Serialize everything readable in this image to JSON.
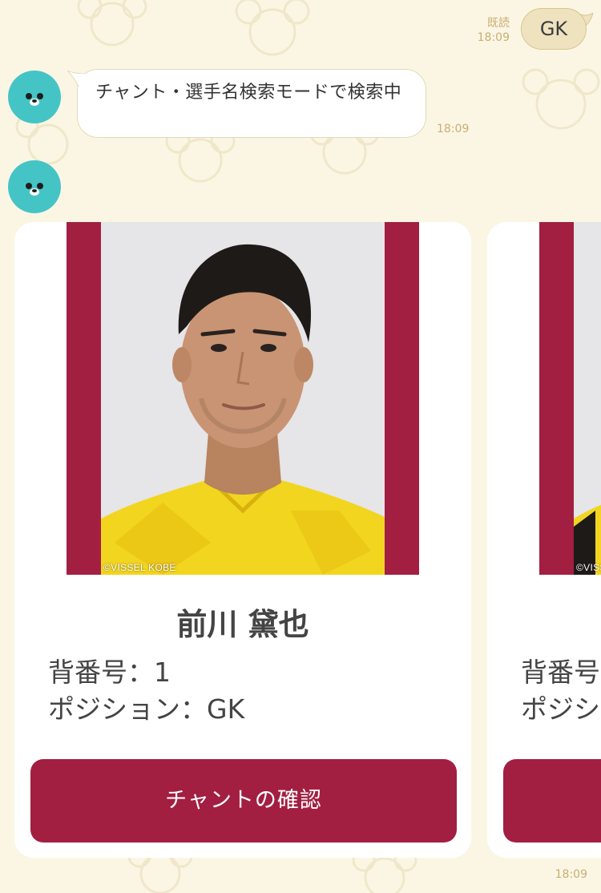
{
  "colors": {
    "chat_background": "#FBF6E4",
    "outgoing_bubble": "#EFE3BF",
    "timestamp": "#C9AE71",
    "avatar": "#45C4C6",
    "brand_crimson": "#A21F42",
    "jersey_yellow": "#F2D51E"
  },
  "outgoing_message": {
    "read_label": "既読",
    "time": "18:09",
    "text": "GK"
  },
  "bot": {
    "avatar_icon": "bear-face-icon"
  },
  "incoming_message": {
    "text": "チャント・選手名検索モードで検索中",
    "time": "18:09"
  },
  "carousel": {
    "time": "18:09",
    "cards": [
      {
        "photo_credit": "©VISSEL KOBE",
        "name": "前川 黛也",
        "number_line": "背番号：1",
        "position_line": "ポジション：GK",
        "button_label": "チャントの確認"
      },
      {
        "photo_credit": "©VISSEL KOBE",
        "name": "",
        "number_line": "背番号：",
        "position_line": "ポジション：",
        "button_label": ""
      }
    ]
  }
}
